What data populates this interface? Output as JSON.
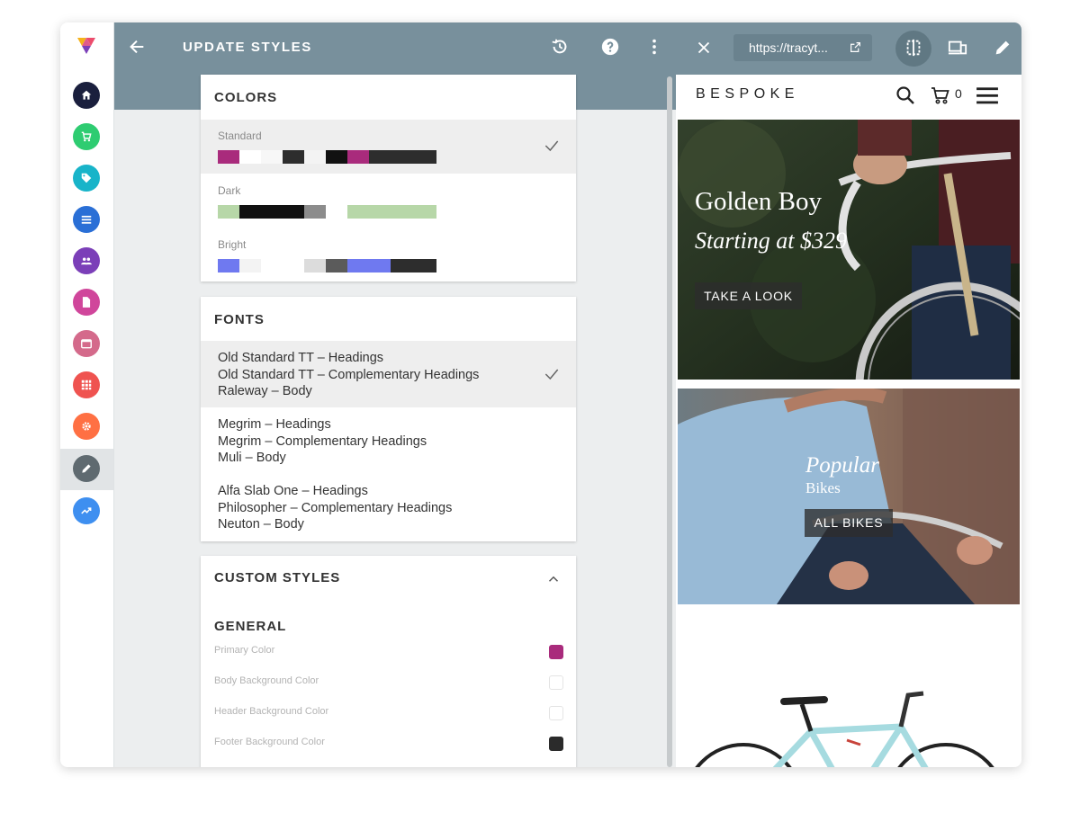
{
  "colors": {
    "header_bar": "#78909c",
    "rail_icons": [
      "#1a1f3d",
      "#2ecc71",
      "#18b4c9",
      "#2a6fd6",
      "#7b3fb8",
      "#d0469b",
      "#d46a8b",
      "#ef5350",
      "#ff7043",
      "#5f6a70",
      "#3e8ff0"
    ],
    "primary": "#a92b7c",
    "footer_background": "#2b2b2b"
  },
  "rail": {
    "icons": [
      "logo-icon",
      "home-icon",
      "cart-icon",
      "tag-icon",
      "list-icon",
      "users-icon",
      "page-icon",
      "calendar-icon",
      "apps-icon",
      "settings-icon",
      "pencil-icon",
      "analytics-icon"
    ]
  },
  "editor": {
    "title": "UPDATE STYLES",
    "icons": [
      "back-arrow-icon",
      "history-icon",
      "help-icon",
      "more-vert-icon"
    ]
  },
  "colors_card": {
    "title": "COLORS",
    "schemes": [
      {
        "name": "Standard",
        "selected": true,
        "swatches": [
          "#a92b7c",
          "#ffffff",
          "#f7f7f7",
          "#2d2d2d",
          "#f3f3f3",
          "#111111",
          "#a92b7c",
          "#2d2d2d"
        ]
      },
      {
        "name": "Dark",
        "selected": false,
        "swatches": [
          "#b7d7a8",
          "#111111",
          "#111111",
          "#8c8c8c",
          "#ffffff",
          "#b7d7a8"
        ]
      },
      {
        "name": "Bright",
        "selected": false,
        "swatches": [
          "#6f79f0",
          "#f3f3f3",
          "#ffffff",
          "#dcdcdc",
          "#5b5b5b",
          "#6f79f0",
          "#2d2d2d"
        ]
      }
    ]
  },
  "fonts_card": {
    "title": "FONTS",
    "options": [
      {
        "lines": [
          "Old Standard TT – Headings",
          "Old Standard TT – Complementary Headings",
          "Raleway – Body"
        ],
        "selected": true
      },
      {
        "lines": [
          "Megrim – Headings",
          "Megrim – Complementary Headings",
          "Muli – Body"
        ],
        "selected": false
      },
      {
        "lines": [
          "Alfa Slab One – Headings",
          "Philosopher – Complementary Headings",
          "Neuton – Body"
        ],
        "selected": false
      }
    ]
  },
  "custom_card": {
    "title": "CUSTOM STYLES",
    "section": "GENERAL",
    "fields": [
      {
        "label": "Primary Color",
        "color": "#a92b7c"
      },
      {
        "label": "Body Background Color",
        "color": "#ffffff"
      },
      {
        "label": "Header Background Color",
        "color": "#ffffff"
      },
      {
        "label": "Footer Background Color",
        "color": "#2b2b2b"
      }
    ]
  },
  "preview": {
    "url": "https://tracyt...",
    "icons": [
      "close-icon",
      "external-link-icon",
      "split-view-icon",
      "devices-icon",
      "edit-icon"
    ],
    "site": {
      "brand": "BESPOKE",
      "cart_count": "0",
      "hero1": {
        "title": "Golden Boy",
        "subtitle": "Starting at $329",
        "button": "TAKE A LOOK"
      },
      "hero2": {
        "title": "Popular",
        "subtitle": "Bikes",
        "button": "ALL BIKES"
      }
    }
  }
}
